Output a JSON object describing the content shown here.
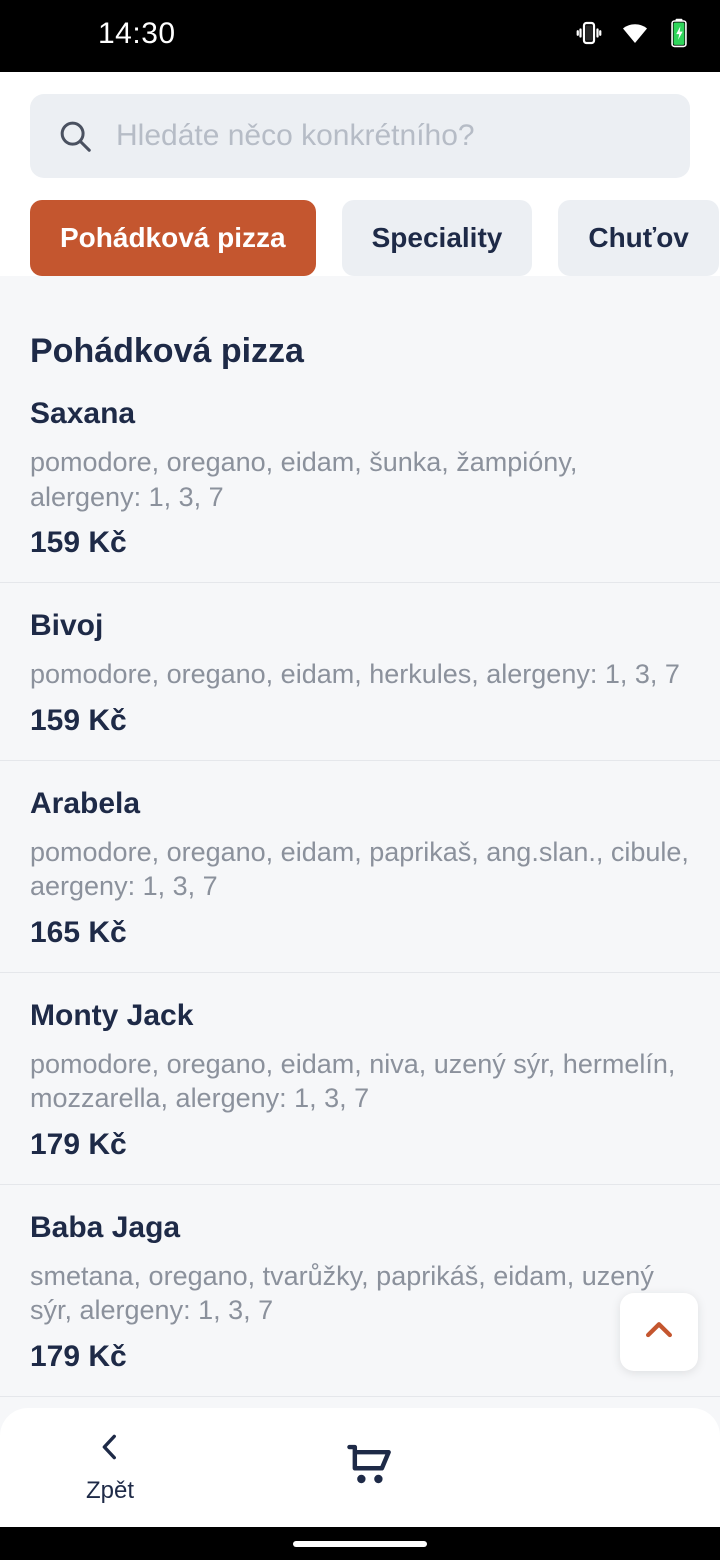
{
  "status_bar": {
    "time": "14:30",
    "icons": [
      "vibrate-icon",
      "wifi-icon",
      "battery-charging-icon"
    ]
  },
  "search": {
    "placeholder": "Hledáte něco konkrétního?",
    "value": "",
    "icon": "search-icon"
  },
  "tabs": [
    {
      "label": "Pohádková pizza",
      "active": true
    },
    {
      "label": "Speciality",
      "active": false
    },
    {
      "label": "Chuťov",
      "active": false
    }
  ],
  "section": {
    "title": "Pohádková pizza"
  },
  "menu_items": [
    {
      "name": "Saxana",
      "description": "pomodore, oregano, eidam, šunka, žampióny, alergeny: 1, 3, 7",
      "price": "159 Kč"
    },
    {
      "name": "Bivoj",
      "description": "pomodore, oregano, eidam, herkules, alergeny: 1, 3, 7",
      "price": "159 Kč"
    },
    {
      "name": "Arabela",
      "description": "pomodore, oregano, eidam, paprikaš, ang.slan., cibule, aergeny: 1, 3, 7",
      "price": "165 Kč"
    },
    {
      "name": "Monty Jack",
      "description": "pomodore, oregano, eidam, niva, uzený sýr, hermelín, mozzarella, alergeny: 1, 3, 7",
      "price": "179 Kč"
    },
    {
      "name": "Baba Jaga",
      "description": "smetana, oregano, tvarůžky, paprikáš, eidam, uzený sýr, alergeny: 1, 3, 7",
      "price": "179 Kč"
    }
  ],
  "scroll_top_button": {
    "icon": "chevron-up-icon"
  },
  "bottom_nav": [
    {
      "label": "Zpět",
      "icon": "chevron-left-icon"
    },
    {
      "label": "",
      "icon": "shopping-cart-icon"
    }
  ],
  "colors": {
    "accent": "#c4562f",
    "text_primary": "#1e2a47",
    "text_muted": "#8b919c",
    "page_bg": "#f6f7f9",
    "chip_bg": "#eceff3"
  }
}
